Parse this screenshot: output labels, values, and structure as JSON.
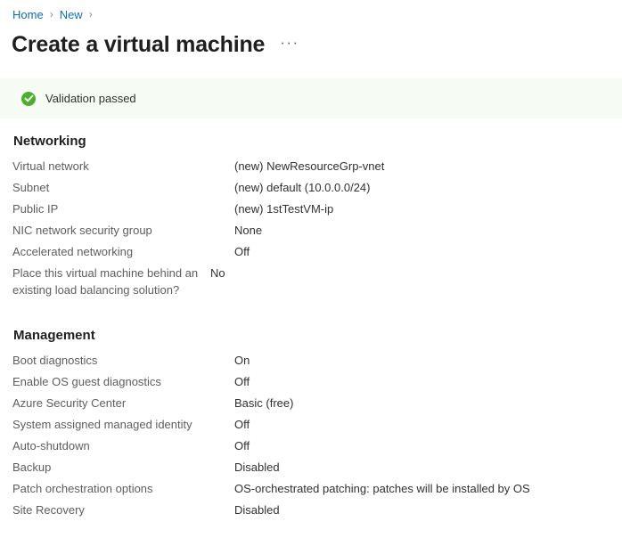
{
  "breadcrumb": {
    "items": [
      {
        "label": "Home"
      },
      {
        "label": "New"
      }
    ],
    "separator": "›"
  },
  "header": {
    "title": "Create a virtual machine",
    "more_menu_label": "···"
  },
  "banner": {
    "icon": "check-circle-icon",
    "text": "Validation passed",
    "background_color": "#f6fbf4",
    "icon_color": "#4caf2f"
  },
  "sections": [
    {
      "id": "networking",
      "heading": "Networking",
      "rows": [
        {
          "label": "Virtual network",
          "value": "(new) NewResourceGrp-vnet"
        },
        {
          "label": "Subnet",
          "value": "(new) default (10.0.0.0/24)"
        },
        {
          "label": "Public IP",
          "value": "(new) 1stTestVM-ip"
        },
        {
          "label": "NIC network security group",
          "value": "None"
        },
        {
          "label": "Accelerated networking",
          "value": "Off"
        },
        {
          "label": "Place this virtual machine behind an existing load balancing solution?",
          "value": "No"
        }
      ]
    },
    {
      "id": "management",
      "heading": "Management",
      "rows": [
        {
          "label": "Boot diagnostics",
          "value": "On"
        },
        {
          "label": "Enable OS guest diagnostics",
          "value": "Off"
        },
        {
          "label": "Azure Security Center",
          "value": "Basic (free)"
        },
        {
          "label": "System assigned managed identity",
          "value": "Off"
        },
        {
          "label": "Auto-shutdown",
          "value": "Off"
        },
        {
          "label": "Backup",
          "value": "Disabled"
        },
        {
          "label": "Patch orchestration options",
          "value": "OS-orchestrated patching: patches will be installed by OS"
        },
        {
          "label": "Site Recovery",
          "value": "Disabled"
        }
      ]
    }
  ],
  "colors": {
    "link": "#0f6cbd",
    "heading": "#201f1e",
    "label": "#605e5c",
    "value": "#323130",
    "success": "#4caf2f"
  }
}
